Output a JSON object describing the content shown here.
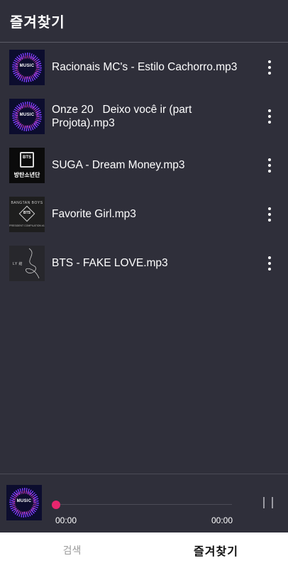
{
  "app_bar": {
    "title": "즐겨찾기"
  },
  "songs": [
    {
      "title": "Racionais MC's - Estilo Cachorro.mp3",
      "thumb": "music-visualizer",
      "thumb_text": "MUSIC"
    },
    {
      "title": "Onze 20   Deixo você ir (part Projota).mp3",
      "thumb": "music-visualizer",
      "thumb_text": "MUSIC"
    },
    {
      "title": "SUGA - Dream Money.mp3",
      "thumb": "bts-emblem",
      "thumb_text": "BTS",
      "thumb_caption": "방탄소년단"
    },
    {
      "title": "Favorite Girl.mp3",
      "thumb": "bangtan-compilation",
      "thumb_text": "BANGTAN BOYS",
      "thumb_badge": "BTS",
      "thumb_caption": "PRESIDENT COMPILATION #1"
    },
    {
      "title": "BTS - FAKE LOVE.mp3",
      "thumb": "love-yourself",
      "thumb_text": "LY 結"
    }
  ],
  "player": {
    "art_text": "MUSIC",
    "time_current": "00:00",
    "time_total": "00:00",
    "progress": 0
  },
  "bottom_nav": {
    "tabs": [
      {
        "label": "검색",
        "active": false
      },
      {
        "label": "즐겨찾기",
        "active": true
      }
    ]
  },
  "colors": {
    "background": "#2f2f3a",
    "accent": "#e8266e",
    "nav_background": "#ffffff"
  },
  "icons": {
    "more": "more-vertical-icon",
    "pause": "pause-icon"
  }
}
